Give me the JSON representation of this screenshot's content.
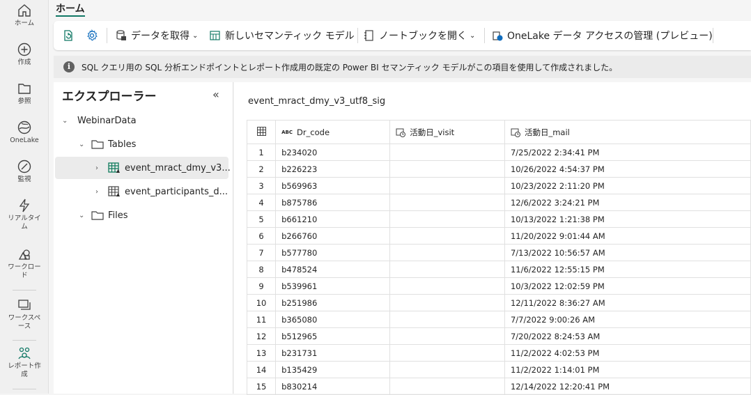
{
  "rail": {
    "items": [
      {
        "label": "ホーム",
        "icon": "home-icon"
      },
      {
        "label": "作成",
        "icon": "create-icon"
      },
      {
        "label": "参照",
        "icon": "browse-icon"
      },
      {
        "label": "OneLake",
        "icon": "onelake-icon"
      },
      {
        "label": "監視",
        "icon": "monitor-icon"
      },
      {
        "label": "リアルタイ",
        "label2": "ム",
        "icon": "realtime-icon"
      },
      {
        "label": "ワークロー",
        "label2": "ド",
        "icon": "workload-icon"
      },
      {
        "label": "ワークスペ",
        "label2": "ース",
        "icon": "workspace-icon"
      },
      {
        "label": "レポート作",
        "label2": "成",
        "icon": "report-icon"
      }
    ]
  },
  "header": {
    "home_tab": "ホーム"
  },
  "toolbar": {
    "get_data": "データを取得",
    "new_model": "新しいセマンティック モデル",
    "open_notebook": "ノートブックを開く",
    "onelake_access": "OneLake データ アクセスの管理 (プレビュー)"
  },
  "banner": {
    "text": "SQL クエリ用の SQL 分析エンドポイントとレポート作成用の既定の Power BI セマンティック モデルがこの項目を使用して作成されました。"
  },
  "explorer": {
    "title": "エクスプローラー",
    "root": "WebinarData",
    "tables_folder": "Tables",
    "tables": [
      "event_mract_dmy_v3...",
      "event_participants_d..."
    ],
    "files_folder": "Files"
  },
  "table": {
    "title": "event_mract_dmy_v3_utf8_sig",
    "columns": [
      "Dr_code",
      "活動日_visit",
      "活動日_mail"
    ],
    "abc_label": "ABC",
    "rows": [
      {
        "n": "1",
        "dr": "b234020",
        "visit": "",
        "mail": "7/25/2022 2:34:41 PM"
      },
      {
        "n": "2",
        "dr": "b226223",
        "visit": "",
        "mail": "10/26/2022 4:54:37 PM"
      },
      {
        "n": "3",
        "dr": "b569963",
        "visit": "",
        "mail": "10/23/2022 2:11:20 PM"
      },
      {
        "n": "4",
        "dr": "b875786",
        "visit": "",
        "mail": "12/6/2022 3:24:21 PM"
      },
      {
        "n": "5",
        "dr": "b661210",
        "visit": "",
        "mail": "10/13/2022 1:21:38 PM"
      },
      {
        "n": "6",
        "dr": "b266760",
        "visit": "",
        "mail": "11/20/2022 9:01:44 AM"
      },
      {
        "n": "7",
        "dr": "b577780",
        "visit": "",
        "mail": "7/13/2022 10:56:57 AM"
      },
      {
        "n": "8",
        "dr": "b478524",
        "visit": "",
        "mail": "11/6/2022 12:55:15 PM"
      },
      {
        "n": "9",
        "dr": "b539961",
        "visit": "",
        "mail": "10/3/2022 12:02:59 PM"
      },
      {
        "n": "10",
        "dr": "b251986",
        "visit": "",
        "mail": "12/11/2022 8:36:27 AM"
      },
      {
        "n": "11",
        "dr": "b365080",
        "visit": "",
        "mail": "7/7/2022 9:00:26 AM"
      },
      {
        "n": "12",
        "dr": "b512965",
        "visit": "",
        "mail": "7/20/2022 8:24:53 AM"
      },
      {
        "n": "13",
        "dr": "b231731",
        "visit": "",
        "mail": "11/2/2022 4:02:53 PM"
      },
      {
        "n": "14",
        "dr": "b135429",
        "visit": "",
        "mail": "11/2/2022 1:14:01 PM"
      },
      {
        "n": "15",
        "dr": "b830214",
        "visit": "",
        "mail": "12/14/2022 12:20:41 PM"
      }
    ]
  },
  "colors": {
    "accent": "#117865",
    "table_icon": "#0f7b5c"
  }
}
